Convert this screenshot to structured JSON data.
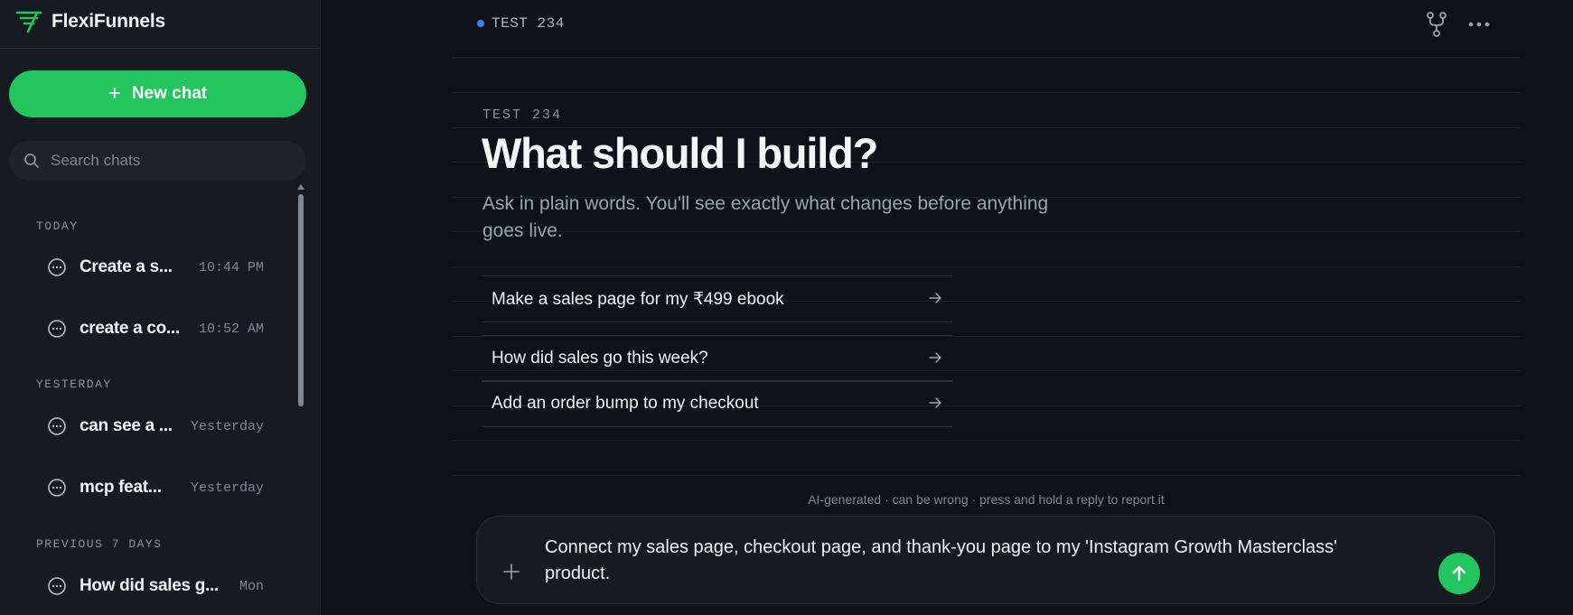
{
  "app": {
    "name": "FlexiFunnels",
    "brand_color": "#22c55e"
  },
  "sidebar": {
    "new_chat_label": "New chat",
    "search_placeholder": "Search chats",
    "sections": [
      {
        "label": "TODAY",
        "items": [
          {
            "title": "Create a s...",
            "time": "10:44 PM"
          },
          {
            "title": "create a co...",
            "time": "10:52 AM"
          }
        ]
      },
      {
        "label": "YESTERDAY",
        "items": [
          {
            "title": "can see a ...",
            "time": "Yesterday"
          },
          {
            "title": "mcp feat...",
            "time": "Yesterday"
          }
        ]
      },
      {
        "label": "PREVIOUS 7 DAYS",
        "items": [
          {
            "title": "How did sales g...",
            "time": "Mon"
          }
        ]
      }
    ]
  },
  "header": {
    "workspace": "TEST 234",
    "status_color": "#3b82f6"
  },
  "main": {
    "eyebrow": "TEST 234",
    "headline": "What should I build?",
    "subtitle": "Ask in plain words. You'll see exactly what changes before anything goes live.",
    "suggestions": [
      {
        "label": "Make a sales page for my ₹499 ebook"
      },
      {
        "label": "How did sales go this week?"
      },
      {
        "label": "Add an order bump to my checkout"
      }
    ]
  },
  "composer": {
    "disclaimer": "AI-generated · can be wrong · press and hold a reply to report it",
    "text": "Connect my sales page, checkout page, and thank-you page to my 'Instagram Growth Masterclass' product."
  },
  "icons": {
    "brand": "flexifunnels-logo-icon",
    "new_chat": "plus-icon",
    "search": "search-icon",
    "chat": "chat-bubble-icon",
    "branch": "branch-icon",
    "more": "more-horizontal-icon",
    "suggestion": "arrow-right-icon",
    "attach": "plus-icon",
    "send": "arrow-up-icon"
  }
}
